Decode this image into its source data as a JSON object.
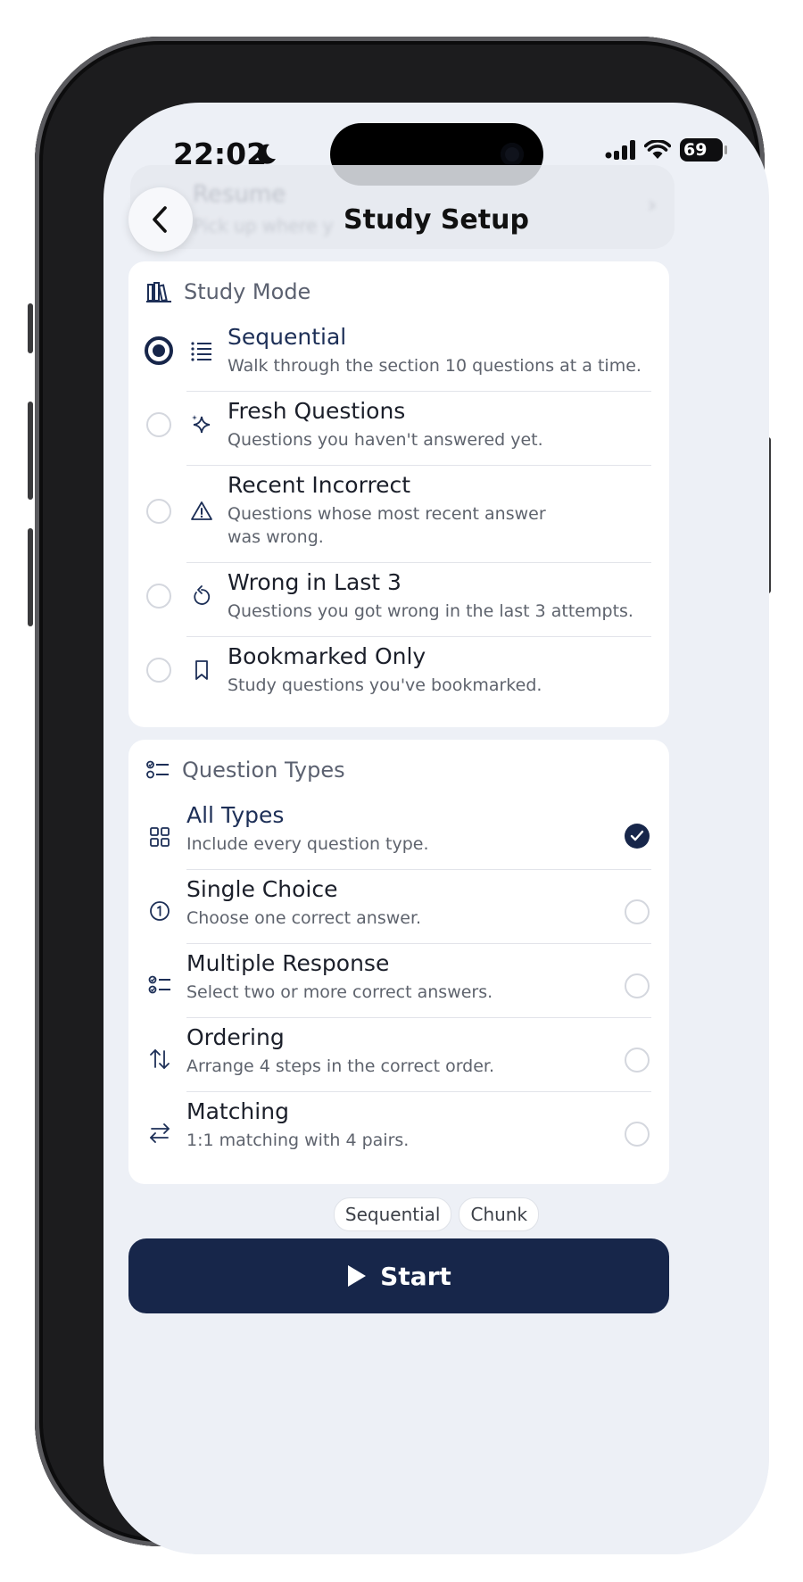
{
  "status": {
    "time": "22:02",
    "battery": "69"
  },
  "ghost": {
    "title": "Resume",
    "subtitle": "Pick up where y"
  },
  "nav": {
    "title": "Study Setup"
  },
  "study_mode": {
    "header": "Study Mode",
    "items": [
      {
        "label": "Sequential",
        "description": "Walk through the section 10 questions at a time.",
        "icon": "list-icon",
        "selected": true
      },
      {
        "label": "Fresh Questions",
        "description": "Questions you haven't answered yet.",
        "icon": "sparkle-icon",
        "selected": false
      },
      {
        "label": "Recent Incorrect",
        "description": "Questions whose most recent answer was wrong.",
        "icon": "warning-icon",
        "selected": false
      },
      {
        "label": "Wrong in Last 3",
        "description": "Questions you got wrong in the last 3 attempts.",
        "icon": "retry-icon",
        "selected": false
      },
      {
        "label": "Bookmarked Only",
        "description": "Study questions you've bookmarked.",
        "icon": "bookmark-icon",
        "selected": false
      }
    ]
  },
  "question_types": {
    "header": "Question Types",
    "items": [
      {
        "label": "All Types",
        "description": "Include every question type.",
        "icon": "grid-icon",
        "checked": true
      },
      {
        "label": "Single Choice",
        "description": "Choose one correct answer.",
        "icon": "number-one-icon",
        "checked": false
      },
      {
        "label": "Multiple Response",
        "description": "Select two or more correct answers.",
        "icon": "checklist-icon",
        "checked": false
      },
      {
        "label": "Ordering",
        "description": "Arrange 4 steps in the correct order.",
        "icon": "sort-arrows-icon",
        "checked": false
      },
      {
        "label": "Matching",
        "description": "1:1 matching with 4 pairs.",
        "icon": "swap-arrows-icon",
        "checked": false
      }
    ]
  },
  "chips": [
    "Sequential",
    "Chunk"
  ],
  "start_label": "Start",
  "colors": {
    "primary": "#17264a",
    "background": "#edf0f6",
    "card": "#ffffff"
  }
}
